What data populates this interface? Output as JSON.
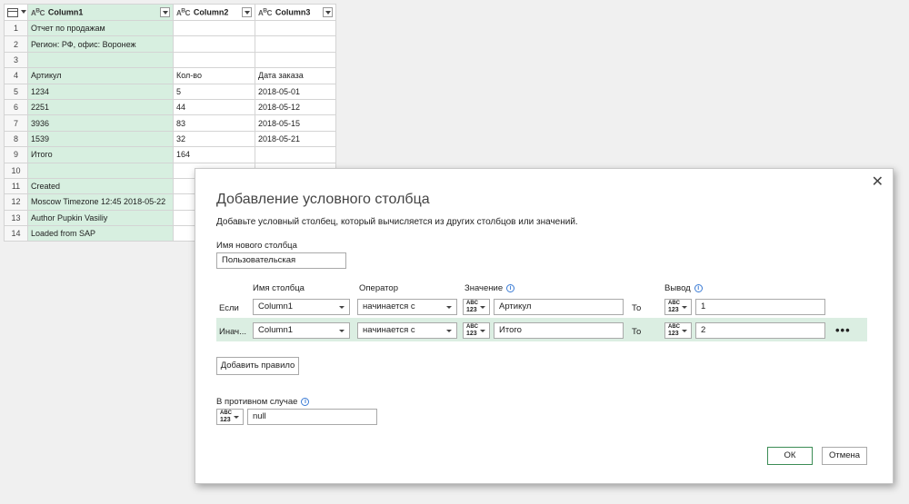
{
  "grid": {
    "columns": [
      "Column1",
      "Column2",
      "Column3"
    ],
    "column_type_icon": "abc-type-icon",
    "rows": [
      {
        "n": "1",
        "c1": "Отчет по продажам",
        "c2": "",
        "c3": ""
      },
      {
        "n": "2",
        "c1": "Регион: РФ, офис: Воронеж",
        "c2": "",
        "c3": ""
      },
      {
        "n": "3",
        "c1": "",
        "c2": "",
        "c3": ""
      },
      {
        "n": "4",
        "c1": "Артикул",
        "c2": "Кол-во",
        "c3": "Дата заказа"
      },
      {
        "n": "5",
        "c1": "1234",
        "c2": "5",
        "c3": "2018-05-01"
      },
      {
        "n": "6",
        "c1": "2251",
        "c2": "44",
        "c3": "2018-05-12"
      },
      {
        "n": "7",
        "c1": "3936",
        "c2": "83",
        "c3": "2018-05-15"
      },
      {
        "n": "8",
        "c1": "1539",
        "c2": "32",
        "c3": "2018-05-21"
      },
      {
        "n": "9",
        "c1": "Итого",
        "c2": "164",
        "c3": ""
      },
      {
        "n": "10",
        "c1": "",
        "c2": "",
        "c3": ""
      },
      {
        "n": "11",
        "c1": "Created",
        "c2": "",
        "c3": ""
      },
      {
        "n": "12",
        "c1": "Moscow Timezone 12:45 2018-05-22",
        "c2": "",
        "c3": ""
      },
      {
        "n": "13",
        "c1": "Author Pupkin Vasiliy",
        "c2": "",
        "c3": ""
      },
      {
        "n": "14",
        "c1": "Loaded from SAP",
        "c2": "",
        "c3": ""
      }
    ]
  },
  "dialog": {
    "title": "Добавление условного столбца",
    "description": "Добавьте условный столбец, который вычисляется из других столбцов или значений.",
    "new_column_label": "Имя нового столбца",
    "new_column_value": "Пользовательская",
    "headers": {
      "column": "Имя столбца",
      "operator": "Оператор",
      "value": "Значение",
      "output": "Вывод"
    },
    "type_label_top": "ABC",
    "type_label_bottom": "123",
    "rules": [
      {
        "prefix": "Если",
        "column": "Column1",
        "operator": "начинается с",
        "value": "Артикул",
        "to": "То",
        "output": "1"
      },
      {
        "prefix": "Инач...",
        "column": "Column1",
        "operator": "начинается с",
        "value": "Итого",
        "to": "То",
        "output": "2"
      }
    ],
    "more_label": "•••",
    "add_rule": "Добавить правило",
    "else_label": "В противном случае",
    "else_value": "null",
    "ok": "ОК",
    "cancel": "Отмена",
    "close_glyph": "✕",
    "info_glyph": "i"
  }
}
